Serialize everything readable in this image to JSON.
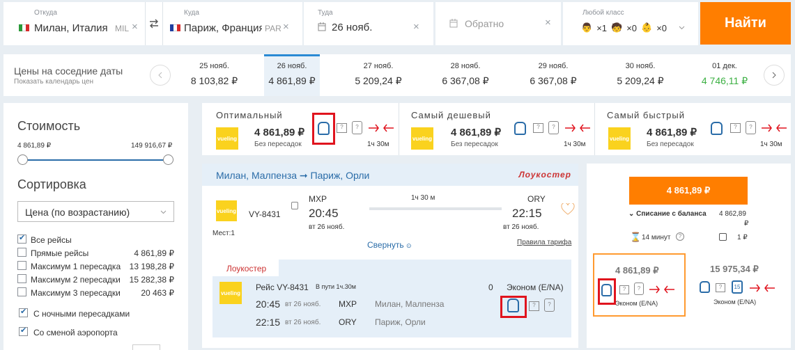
{
  "search": {
    "from_label": "Откуда",
    "from_value": "Милан, Италия",
    "from_code": "MIL",
    "to_label": "Куда",
    "to_value": "Париж, Франция",
    "to_code": "PAR",
    "depart_label": "Туда",
    "depart_value": "26 нояб.",
    "return_placeholder": "Обратно",
    "class_label": "Любой класс",
    "adults": "×1",
    "children": "×0",
    "infants": "×0",
    "search_button": "Найти"
  },
  "dates": {
    "title": "Цены на соседние даты",
    "subtitle": "Показать календарь цен",
    "items": [
      {
        "date": "25 нояб.",
        "price": "8 103,82 ₽"
      },
      {
        "date": "26 нояб.",
        "price": "4 861,89 ₽"
      },
      {
        "date": "27 нояб.",
        "price": "5 209,24 ₽"
      },
      {
        "date": "28 нояб.",
        "price": "6 367,08 ₽"
      },
      {
        "date": "29 нояб.",
        "price": "6 367,08 ₽"
      },
      {
        "date": "30 нояб.",
        "price": "5 209,24 ₽"
      },
      {
        "date": "01 дек.",
        "price": "4 746,11 ₽"
      }
    ]
  },
  "filters": {
    "cost_title": "Стоимость",
    "price_min": "4 861,89 ₽",
    "price_max": "149 916,67 ₽",
    "sort_title": "Сортировка",
    "sort_value": "Цена (по возрастанию)",
    "options": [
      {
        "label": "Все рейсы",
        "price": ""
      },
      {
        "label": "Прямые рейсы",
        "price": "4 861,89 ₽"
      },
      {
        "label": "Максимум 1 пересадка",
        "price": "13 198,28 ₽"
      },
      {
        "label": "Максимум 2 пересадки",
        "price": "15 282,38 ₽"
      },
      {
        "label": "Максимум 3 пересадки",
        "price": "20 463 ₽"
      }
    ],
    "night": "С ночными пересадками",
    "airport_change": "Со сменой аэропорта"
  },
  "summary": [
    {
      "title": "Оптимальный",
      "price": "4 861,89 ₽",
      "stops": "Без пересадок",
      "duration": "1ч 30м"
    },
    {
      "title": "Самый дешевый",
      "price": "4 861,89 ₽",
      "stops": "Без пересадок",
      "duration": "1ч 30м"
    },
    {
      "title": "Самый быстрый",
      "price": "4 861,89 ₽",
      "stops": "Без пересадок",
      "duration": "1ч 30м"
    }
  ],
  "airline_logo": "vueling",
  "flight": {
    "route": "Милан, Малпенза ➞ Париж, Орли",
    "lowcost": "Лоукостер",
    "flight_no": "VY-8431",
    "seats": "Мест:1",
    "dep_code": "MXP",
    "dep_time": "20:45",
    "dep_date": "вт 26 нояб.",
    "duration": "1ч 30 м",
    "arr_code": "ORY",
    "arr_time": "22:15",
    "arr_date": "вт 26 нояб.",
    "collapse": "Свернуть",
    "fare_rules": "Правила тарифа",
    "detail_tag": "Лоукостер",
    "detail_flight": "Рейс VY-8431",
    "detail_duration": "В пути 1ч.30м",
    "detail_zero": "0",
    "detail_class": "Эконом (E/NA)",
    "seg_dep_time": "20:45",
    "seg_dep_date": "вт 26 нояб.",
    "seg_dep_code": "MXP",
    "seg_dep_city": "Милан, Малпенза",
    "seg_arr_time": "22:15",
    "seg_arr_date": "вт 26 нояб.",
    "seg_arr_code": "ORY",
    "seg_arr_city": "Париж, Орли"
  },
  "booking": {
    "price_button": "4 861,89 ₽",
    "balance_label": "Списание с баланса",
    "balance_value": "4 862,89",
    "balance_rub": "₽",
    "timer": "14 минут",
    "bonus": "1 ₽",
    "fare1_price": "4 861,89 ₽",
    "fare1_class": "Эконом (E/NA)",
    "fare2_price": "15 975,34 ₽",
    "fare2_class": "Эконом (E/NA)",
    "fare2_badge": "15"
  },
  "colors": {
    "accent": "#ff7e00",
    "link": "#2a6ca8",
    "green": "#3cb043",
    "red": "#e0141e"
  }
}
